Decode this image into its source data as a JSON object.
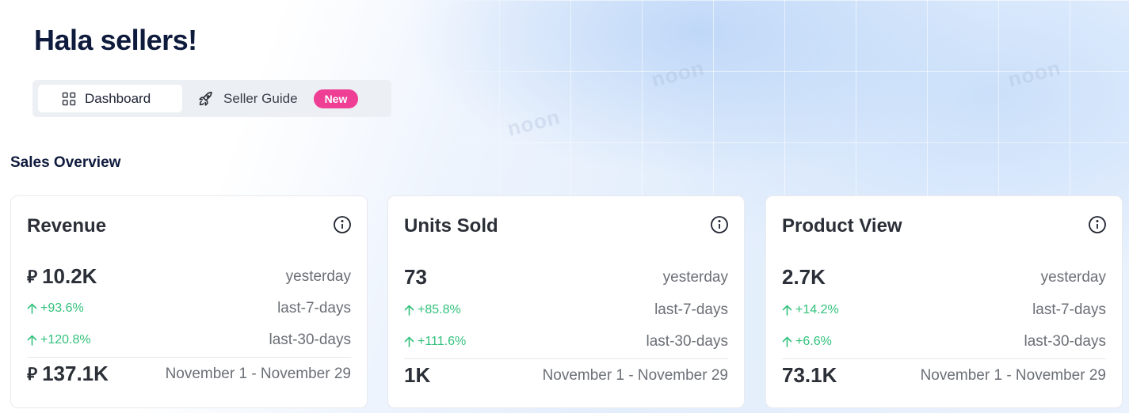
{
  "header": {
    "title": "Hala sellers!"
  },
  "tabs": [
    {
      "label": "Dashboard",
      "icon": "grid-icon",
      "active": true
    },
    {
      "label": "Seller Guide",
      "icon": "rocket-icon",
      "badge": "New"
    }
  ],
  "watermark": "noon",
  "section": {
    "title": "Sales Overview"
  },
  "colors": {
    "badge": "#ee3f95",
    "positive": "#33c27c",
    "title": "#0f1b3d"
  },
  "cards": [
    {
      "title": "Revenue",
      "currency": "⃁",
      "yesterday_value": "10.2K",
      "yesterday_label": "yesterday",
      "last7_pct": "+93.6%",
      "last7_label": "last-7-days",
      "last30_pct": "+120.8%",
      "last30_label": "last-30-days",
      "range_value": "137.1K",
      "range_label": "November 1 - November 29"
    },
    {
      "title": "Units Sold",
      "yesterday_value": "73",
      "yesterday_label": "yesterday",
      "last7_pct": "+85.8%",
      "last7_label": "last-7-days",
      "last30_pct": "+111.6%",
      "last30_label": "last-30-days",
      "range_value": "1K",
      "range_label": "November 1 - November 29"
    },
    {
      "title": "Product View",
      "yesterday_value": "2.7K",
      "yesterday_label": "yesterday",
      "last7_pct": "+14.2%",
      "last7_label": "last-7-days",
      "last30_pct": "+6.6%",
      "last30_label": "last-30-days",
      "range_value": "73.1K",
      "range_label": "November 1 - November 29"
    }
  ]
}
